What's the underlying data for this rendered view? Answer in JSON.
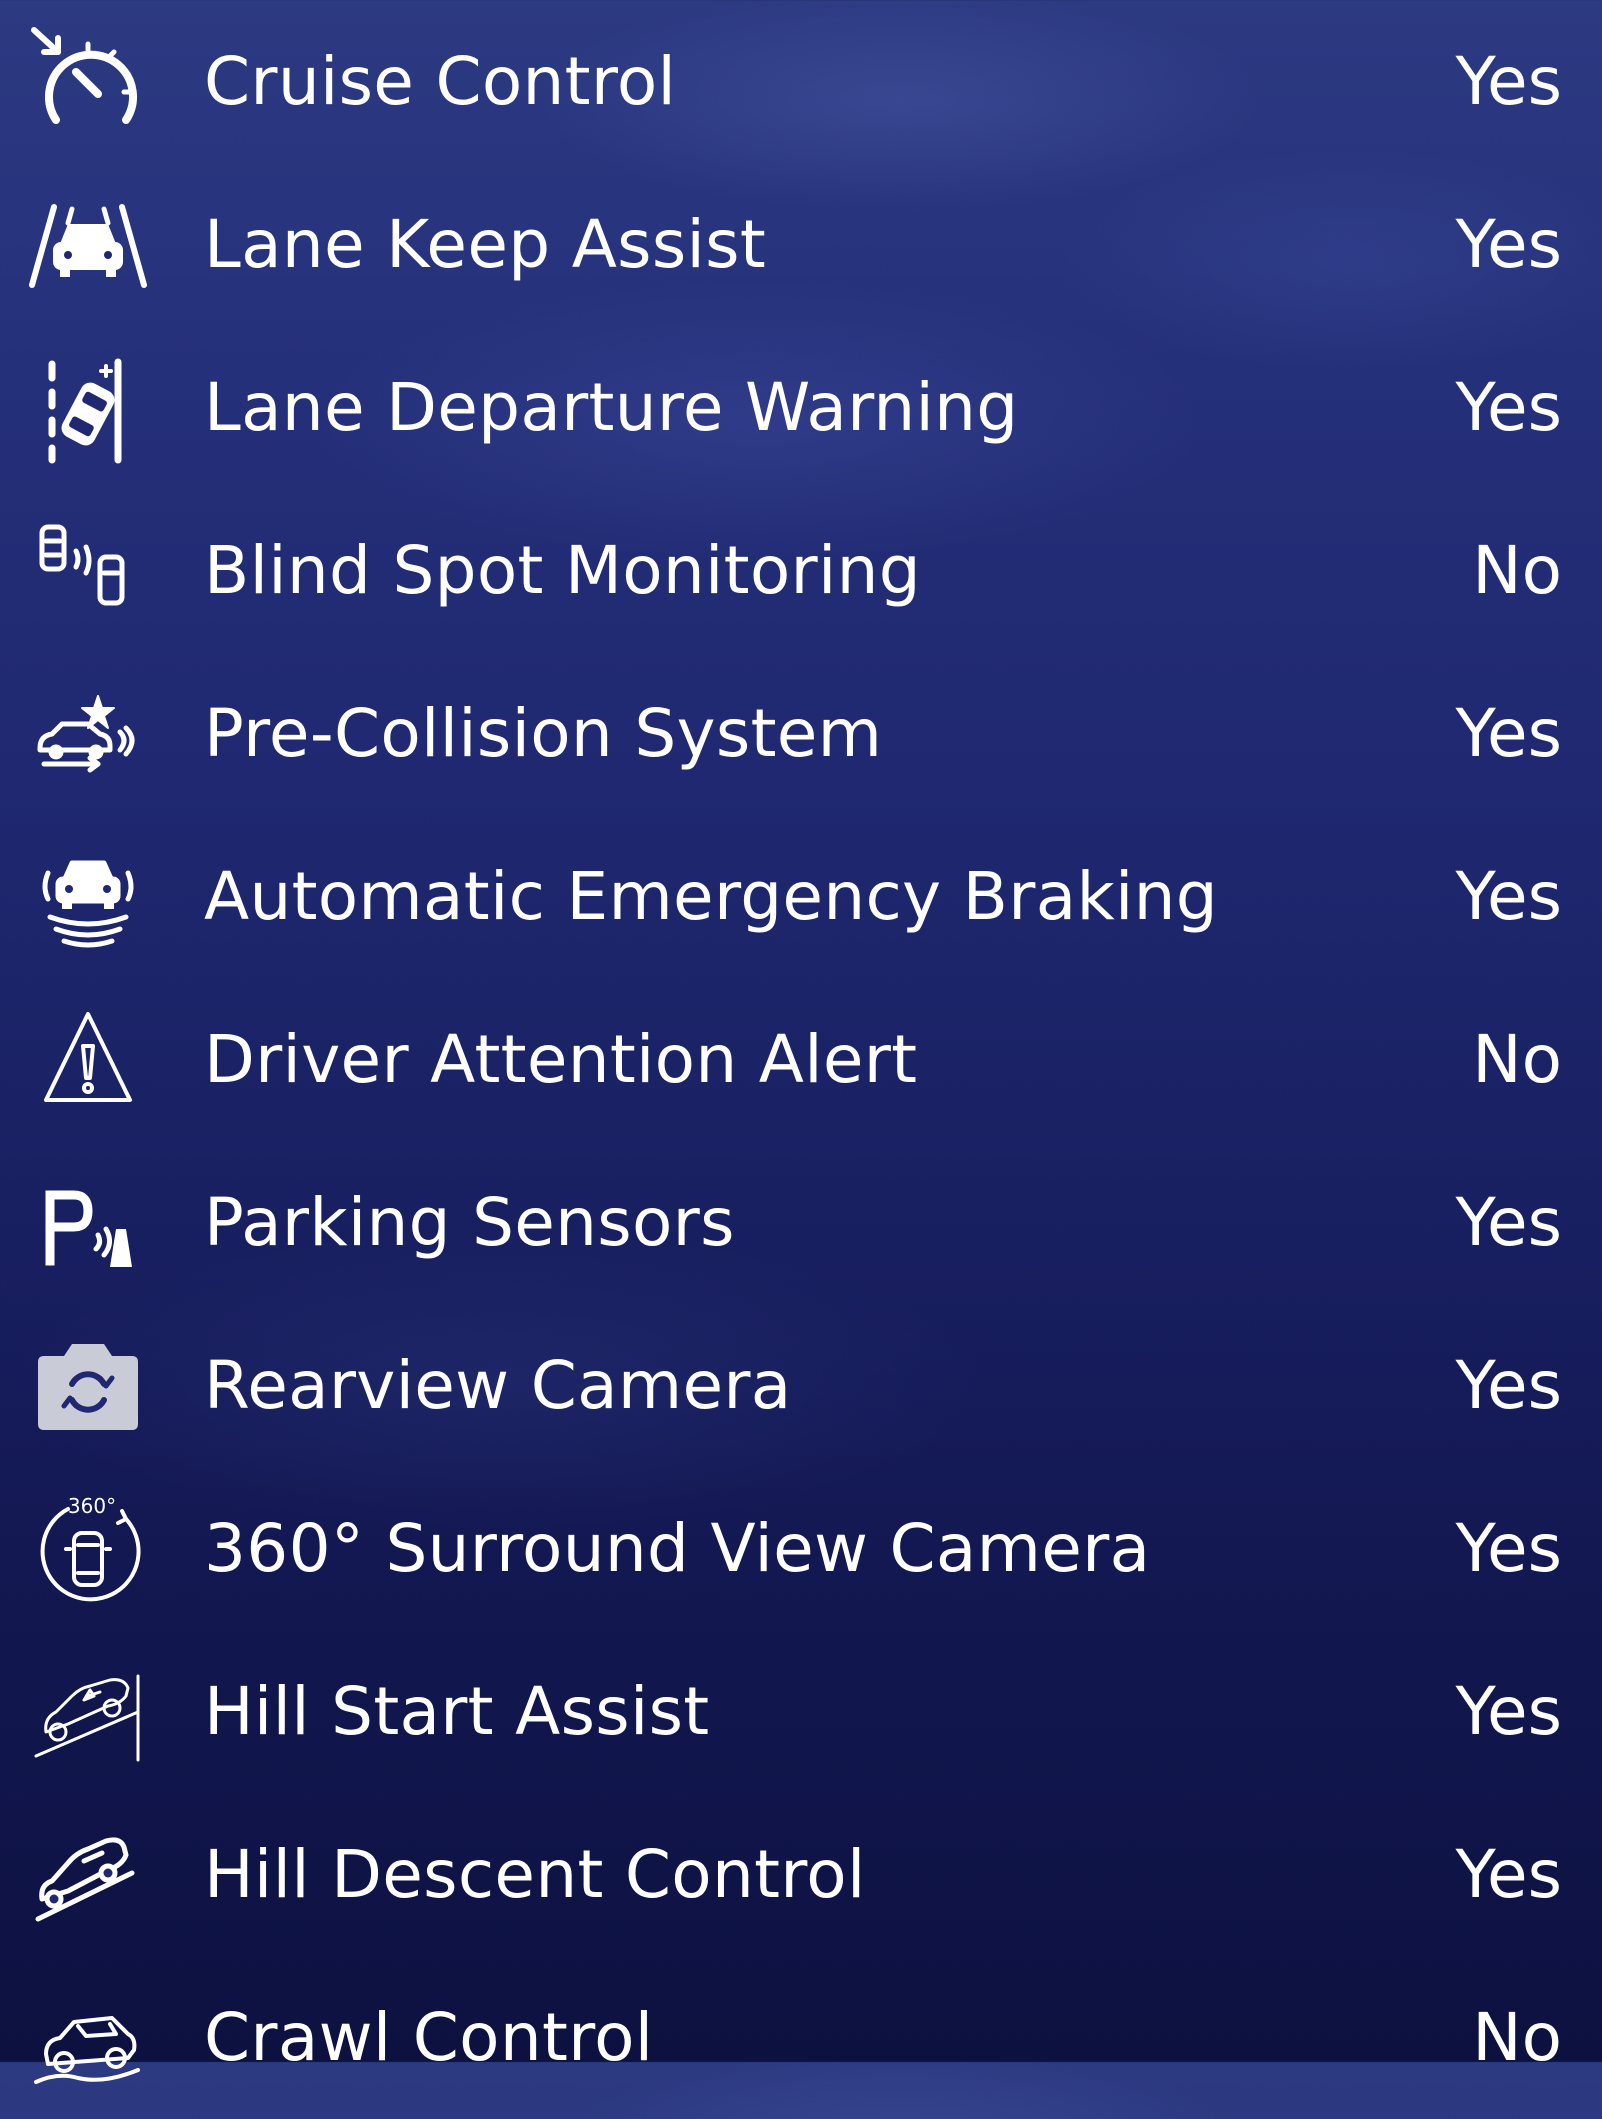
{
  "features": [
    {
      "label": "Cruise Control",
      "value": "Yes",
      "icon": "speedometer-icon"
    },
    {
      "label": "Lane Keep Assist",
      "value": "Yes",
      "icon": "car-lanes-icon"
    },
    {
      "label": "Lane Departure Warning",
      "value": "Yes",
      "icon": "lane-departure-icon"
    },
    {
      "label": "Blind Spot Monitoring",
      "value": "No",
      "icon": "blind-spot-icon"
    },
    {
      "label": "Pre-Collision System",
      "value": "Yes",
      "icon": "collision-icon"
    },
    {
      "label": "Automatic Emergency Braking",
      "value": "Yes",
      "icon": "emergency-brake-icon"
    },
    {
      "label": "Driver Attention Alert",
      "value": "No",
      "icon": "warning-triangle-icon"
    },
    {
      "label": "Parking Sensors",
      "value": "Yes",
      "icon": "parking-sensor-icon"
    },
    {
      "label": "Rearview Camera",
      "value": "Yes",
      "icon": "camera-rotate-icon"
    },
    {
      "label": "360° Surround View Camera",
      "value": "Yes",
      "icon": "camera-360-icon"
    },
    {
      "label": "Hill Start Assist",
      "value": "Yes",
      "icon": "hill-start-icon"
    },
    {
      "label": "Hill Descent Control",
      "value": "Yes",
      "icon": "hill-descent-icon"
    },
    {
      "label": "Crawl Control",
      "value": "No",
      "icon": "crawl-control-icon"
    }
  ],
  "icon_360_text": "360°",
  "colors": {
    "text": "#ffffff",
    "background_top": "#2c3a82",
    "background_bottom": "#0d1140"
  }
}
